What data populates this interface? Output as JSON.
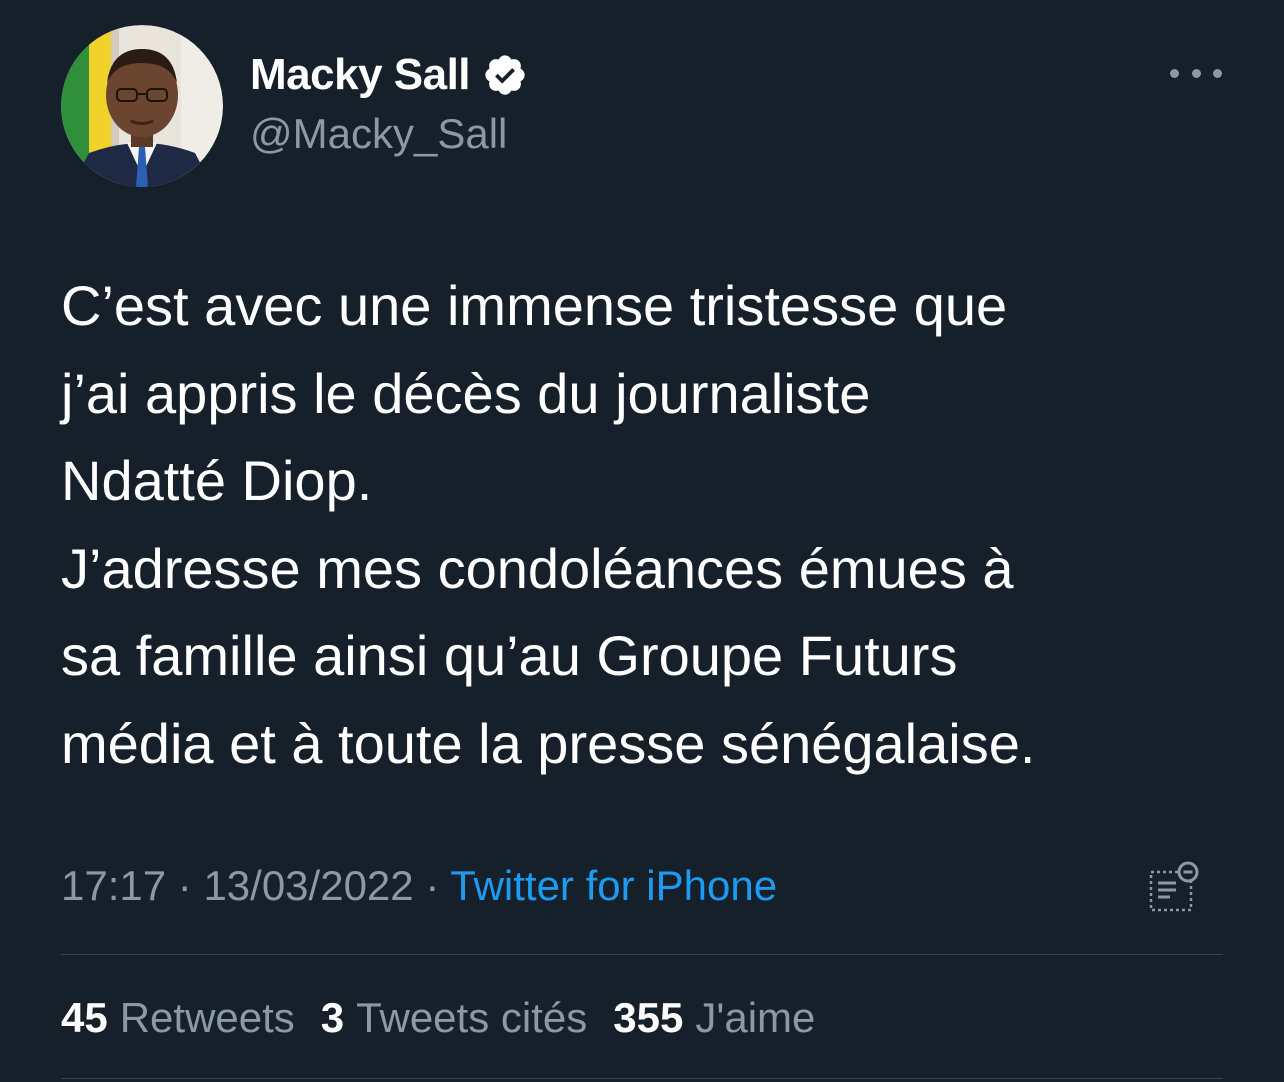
{
  "author": {
    "display_name": "Macky Sall",
    "handle": "@Macky_Sall",
    "verified_icon": "verified-badge-icon"
  },
  "tweet": {
    "lines": [
      "C’est avec une immense tristesse que",
      "j’ai appris le décès du journaliste",
      "Ndatté Diop.",
      "J’adresse mes condoléances émues à",
      "sa famille ainsi qu’au Groupe Futurs",
      "média et à toute la presse sénégalaise."
    ]
  },
  "meta": {
    "time": "17:17",
    "separator": "·",
    "date": "13/03/2022",
    "source": "Twitter for iPhone"
  },
  "stats": {
    "retweets": {
      "count": "45",
      "label": "Retweets"
    },
    "quotes": {
      "count": "3",
      "label": "Tweets cités"
    },
    "likes": {
      "count": "355",
      "label": "J'aime"
    }
  },
  "colors": {
    "background": "#15202b",
    "secondary_text": "#8b98a5",
    "link": "#1d9bf0",
    "divider": "#38444d"
  }
}
